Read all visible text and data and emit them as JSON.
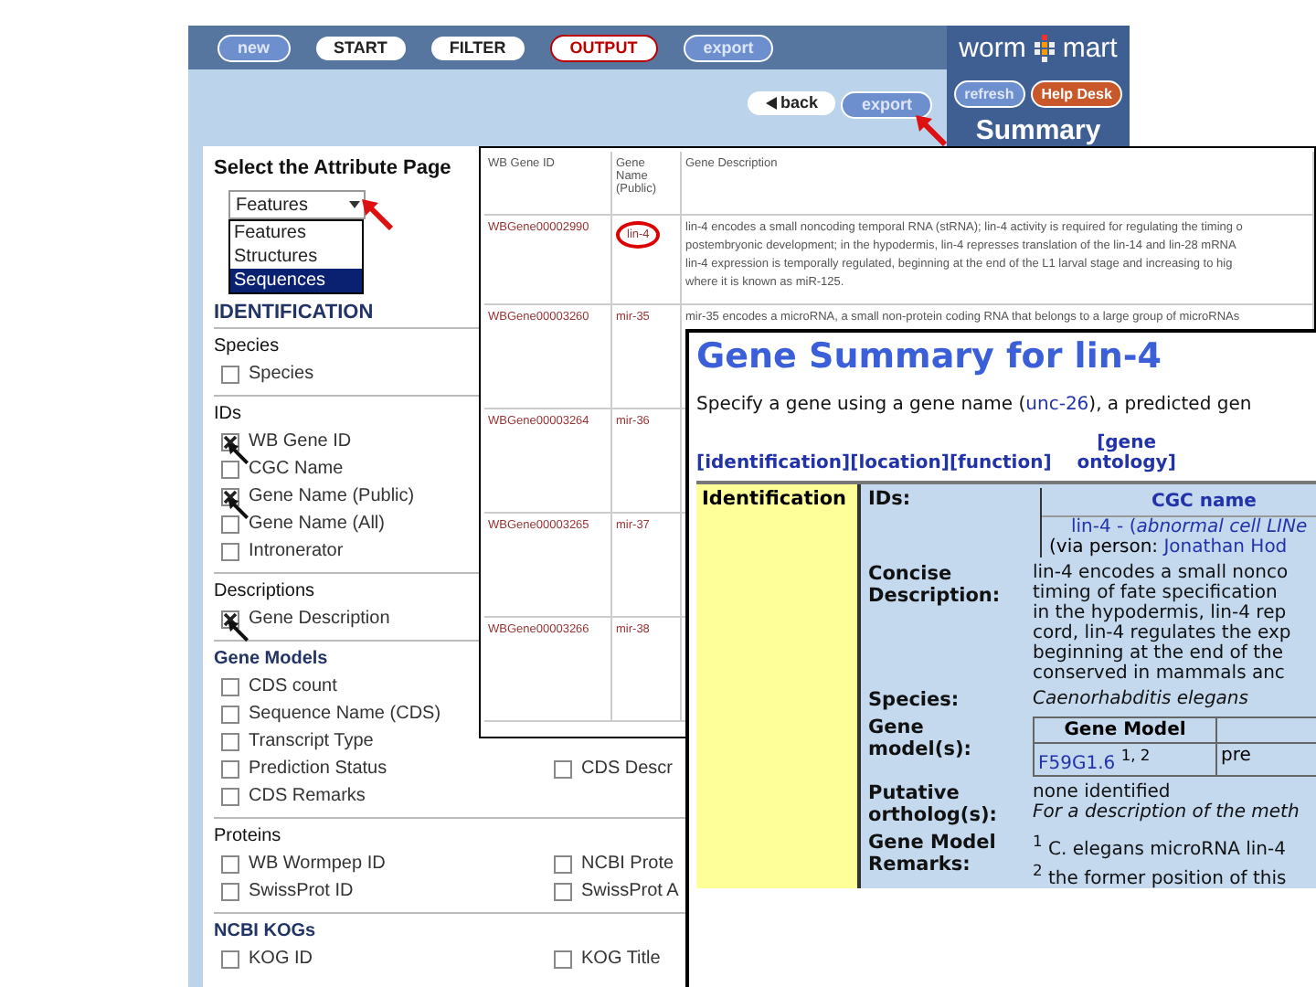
{
  "nav_bar": {
    "buttons": [
      {
        "label": "new",
        "kind": "blue"
      },
      {
        "label": "START",
        "kind": "step"
      },
      {
        "label": "FILTER",
        "kind": "step"
      },
      {
        "label": "OUTPUT",
        "kind": "current"
      },
      {
        "label": "export",
        "kind": "blue"
      }
    ],
    "logo": {
      "left": "worm",
      "right": "mart"
    }
  },
  "sub_bar": {
    "back": "back",
    "export": {
      "label": "export",
      "annotated": true
    }
  },
  "side_panel": {
    "buttons": [
      {
        "label": "refresh",
        "kind": "blue"
      },
      {
        "label": "Help Desk",
        "kind": "orange"
      }
    ],
    "title": "Summary"
  },
  "attribute_panel": {
    "title": "Select the Attribute Page",
    "select": {
      "value": "Features",
      "annotated": true
    },
    "dropdown": [
      {
        "label": "Features",
        "selected": false
      },
      {
        "label": "Structures",
        "selected": false
      },
      {
        "label": "Sequences",
        "selected": true
      }
    ],
    "heading": "IDENTIFICATION",
    "sections": [
      {
        "title": "Species",
        "emphasized": false,
        "items": [
          {
            "label": "Species",
            "checked": false,
            "annotated": false
          }
        ]
      },
      {
        "title": "IDs",
        "emphasized": false,
        "items": [
          {
            "label": "WB Gene ID",
            "checked": true,
            "annotated": true
          },
          {
            "label": "CGC Name",
            "checked": false,
            "annotated": false
          },
          {
            "label": "Gene Name (Public)",
            "checked": true,
            "annotated": true
          },
          {
            "label": "Gene Name (All)",
            "checked": false,
            "annotated": false
          },
          {
            "label": "Intronerator",
            "checked": false,
            "annotated": false
          }
        ]
      },
      {
        "title": "Descriptions",
        "emphasized": false,
        "items": [
          {
            "label": "Gene Description",
            "checked": true,
            "annotated": true
          }
        ]
      },
      {
        "title": "Gene Models",
        "emphasized": true,
        "items": [
          {
            "label": "CDS count",
            "checked": false,
            "annotated": false
          },
          {
            "label": "Sequence Name (CDS)",
            "checked": false,
            "annotated": false
          },
          {
            "label": "Transcript Type",
            "checked": false,
            "annotated": false
          },
          {
            "label": "Prediction Status",
            "checked": false,
            "annotated": false,
            "partner": {
              "label": "CDS Descr",
              "checked": false
            }
          },
          {
            "label": "CDS Remarks",
            "checked": false,
            "annotated": false
          }
        ]
      },
      {
        "title": "Proteins",
        "emphasized": false,
        "items": [
          {
            "label": "WB Wormpep ID",
            "checked": false,
            "annotated": false,
            "partner": {
              "label": "NCBI Prote",
              "checked": false
            }
          },
          {
            "label": "SwissProt ID",
            "checked": false,
            "annotated": false,
            "partner": {
              "label": "SwissProt A",
              "checked": false
            }
          }
        ]
      },
      {
        "title": "NCBI KOGs",
        "emphasized": true,
        "items": [
          {
            "label": "KOG ID",
            "checked": false,
            "annotated": false,
            "partner": {
              "label": "KOG Title",
              "checked": false
            }
          }
        ]
      }
    ]
  },
  "results_table": {
    "columns": [
      "WB Gene ID",
      "Gene Name (Public)",
      "Gene Description"
    ],
    "rows": [
      {
        "gene_id": "WBGene00002990",
        "gene_name": "lin-4",
        "circled": true,
        "description": [
          "lin-4 encodes a small noncoding temporal RNA (stRNA); lin-4 activity is required for regulating the timing o",
          "postembryonic development; in the hypodermis, lin-4 represses translation of the lin-14 and lin-28 mRNA",
          "lin-4 expression is temporally regulated, beginning at the end of the L1 larval stage and increasing to hig",
          "where it is known as miR-125."
        ]
      },
      {
        "gene_id": "WBGene00003260",
        "gene_name": "mir-35",
        "circled": false,
        "description": [
          "mir-35 encodes a microRNA, a small non-protein coding RNA that belongs to a large group of microRNAs"
        ]
      },
      {
        "gene_id": "WBGene00003264",
        "gene_name": "mir-36",
        "circled": false,
        "description": []
      },
      {
        "gene_id": "WBGene00003265",
        "gene_name": "mir-37",
        "circled": false,
        "description": []
      },
      {
        "gene_id": "WBGene00003266",
        "gene_name": "mir-38",
        "circled": false,
        "description": []
      }
    ]
  },
  "gene_summary": {
    "title": "Gene Summary for lin-4",
    "intro": {
      "before": "Specify a gene using a gene name (",
      "link": "unc-26",
      "after": "), a predicted gen"
    },
    "links": [
      "[identification]",
      "[location]",
      "[function]",
      "[gene ontology]"
    ],
    "section": "Identification",
    "rows": [
      {
        "kind": "ids",
        "label": "IDs:",
        "header": "CGC name",
        "line1": "lin-4 - (*abnormal cell LINe*",
        "line2_before": "(via person: ",
        "line2_link": "Jonathan Hod"
      },
      {
        "kind": "lines",
        "label": "Concise Description:",
        "lines": [
          {
            "text": "lin-4 encodes a small nonco",
            "italic": false
          },
          {
            "text": "timing of fate specification",
            "italic": false
          },
          {
            "text": "in the hypodermis, lin-4 rep",
            "italic": false
          },
          {
            "text": "cord, lin-4 regulates the exp",
            "italic": false
          },
          {
            "text": "beginning at the end of the",
            "italic": false
          },
          {
            "text": "conserved in mammals anc",
            "italic": false
          }
        ]
      },
      {
        "kind": "lines",
        "label": "Species:",
        "lines": [
          {
            "text": "Caenorhabditis elegans",
            "italic": true
          }
        ]
      },
      {
        "kind": "models",
        "label": "Gene model(s):",
        "header": "Gene Model",
        "models": [
          {
            "model": "F59G1.6",
            "note": "1, 2",
            "column_2": "pre"
          }
        ]
      },
      {
        "kind": "lines",
        "label": "Putative ortholog(s):",
        "lines": [
          {
            "text": "none identified",
            "italic": false
          },
          {
            "text": "For a description of the meth",
            "italic": true
          }
        ]
      },
      {
        "kind": "remarks",
        "label": "Gene Model Remarks:",
        "remarks": [
          {
            "mark": "1",
            "text": "C. elegans microRNA lin-4"
          },
          {
            "mark": "2",
            "text": "the former position of this"
          }
        ]
      }
    ]
  }
}
